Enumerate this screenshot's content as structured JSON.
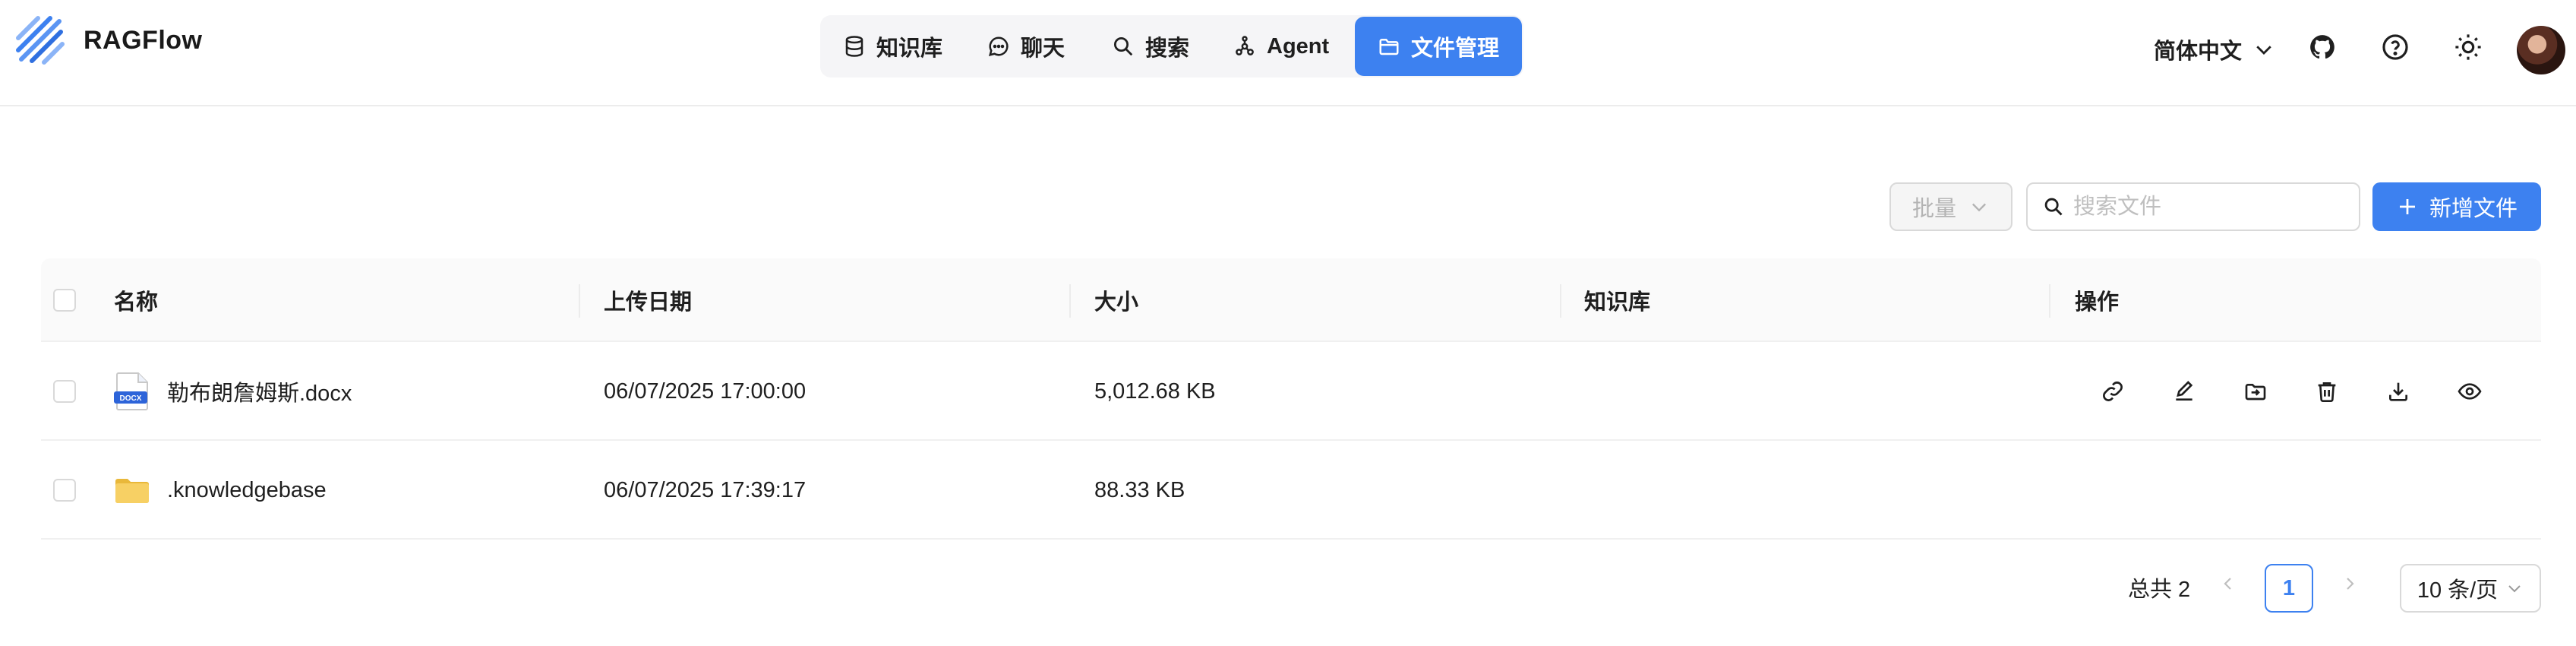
{
  "app": {
    "name": "RAGFlow"
  },
  "nav": {
    "items": [
      {
        "label": "知识库",
        "icon": "database-icon",
        "active": false
      },
      {
        "label": "聊天",
        "icon": "chat-icon",
        "active": false
      },
      {
        "label": "搜索",
        "icon": "search-icon",
        "active": false
      },
      {
        "label": "Agent",
        "icon": "agent-graph-icon",
        "active": false
      },
      {
        "label": "文件管理",
        "icon": "folder-icon",
        "active": true
      }
    ]
  },
  "header": {
    "language": "简体中文",
    "icons": [
      "github-icon",
      "help-icon",
      "theme-toggle-icon"
    ]
  },
  "toolbar": {
    "bulk_label": "批量",
    "search_placeholder": "搜索文件",
    "search_value": "",
    "add_label": "新增文件"
  },
  "table": {
    "columns": [
      "名称",
      "上传日期",
      "大小",
      "知识库",
      "操作"
    ],
    "rows": [
      {
        "name": "勒布朗詹姆斯.docx",
        "type": "docx",
        "type_badge": "DOCX",
        "date": "06/07/2025 17:00:00",
        "size": "5,012.68 KB",
        "kb": "",
        "has_actions": true
      },
      {
        "name": ".knowledgebase",
        "type": "folder",
        "date": "06/07/2025 17:39:17",
        "size": "88.33 KB",
        "kb": "",
        "has_actions": false
      }
    ],
    "row_actions": [
      "link-icon",
      "edit-icon",
      "move-icon",
      "delete-icon",
      "download-icon",
      "preview-icon"
    ]
  },
  "pagination": {
    "total_label": "总共 2",
    "current_page": "1",
    "page_size_label": "10 条/页"
  },
  "colors": {
    "primary": "#3d81f0",
    "folder": "#f5c94a"
  }
}
